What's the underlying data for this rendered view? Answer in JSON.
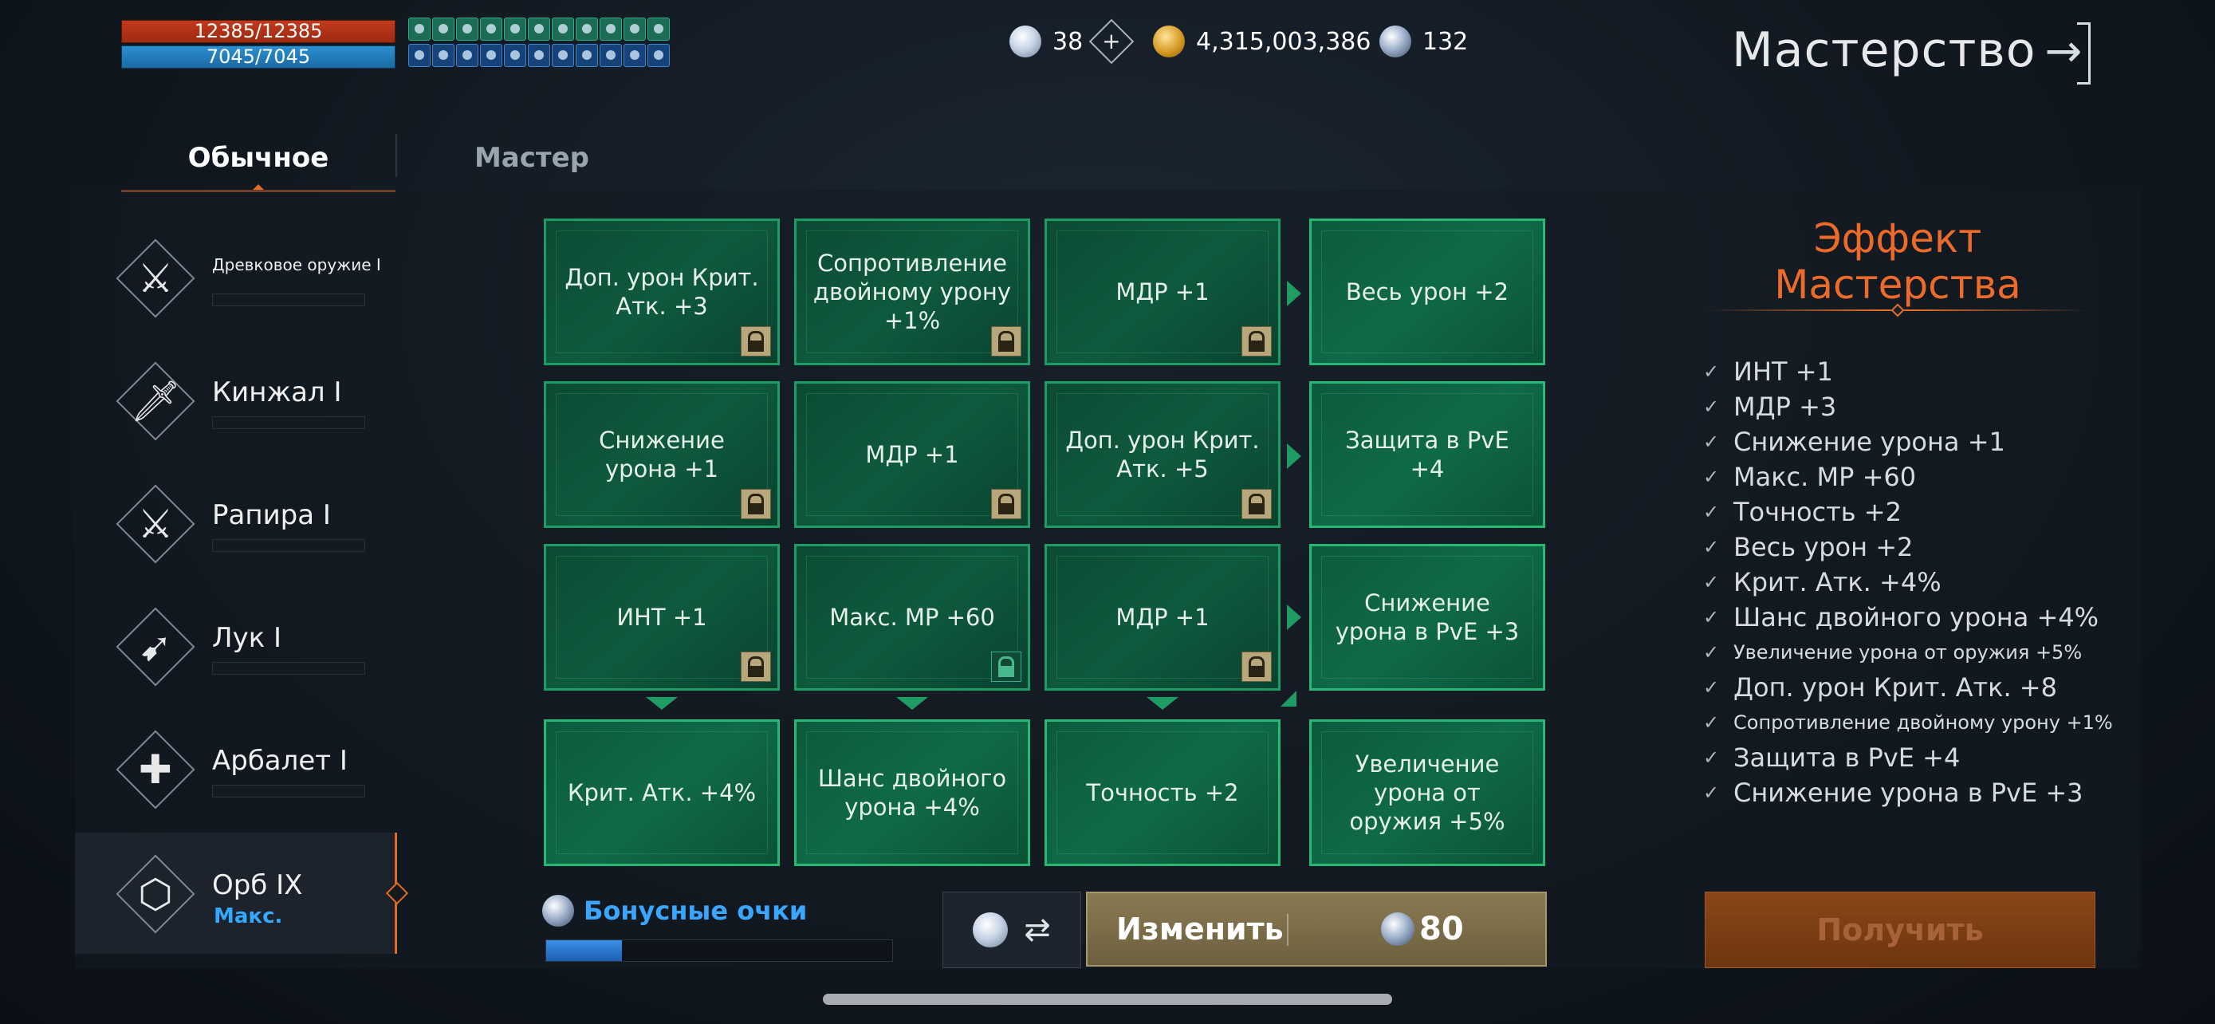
{
  "hud": {
    "hp": "12385/12385",
    "mp": "7045/7045",
    "buffs_green": [
      "buff",
      "buff",
      "buff",
      "buff",
      "buff",
      "buff",
      "buff",
      "buff",
      "buff",
      "buff",
      "buff"
    ],
    "buffs_blue": [
      "buff",
      "buff",
      "buff",
      "buff",
      "buff",
      "buff",
      "buff",
      "buff",
      "buff",
      "buff",
      "buff"
    ]
  },
  "currency": {
    "diamonds": "38",
    "gold": "4,315,003,386",
    "orbs": "132"
  },
  "title": "Мастерство",
  "tabs": [
    {
      "label": "Обычное",
      "active": true
    },
    {
      "label": "Мастер",
      "active": false
    }
  ],
  "weapons": [
    {
      "name": "Древковое оружие",
      "rank": "I"
    },
    {
      "name": "Кинжал",
      "rank": "I"
    },
    {
      "name": "Рапира",
      "rank": "I"
    },
    {
      "name": "Лук",
      "rank": "I"
    },
    {
      "name": "Арбалет",
      "rank": "I"
    },
    {
      "name": "Орб",
      "rank": "IX",
      "status": "Макс."
    }
  ],
  "grid": [
    [
      "Доп. урон Крит.\nАтк. +3",
      "Сопротивление\nдвойному урону\n+1%",
      "МДР +1",
      "Весь урон +2"
    ],
    [
      "Снижение\nурона +1",
      "МДР +1",
      "Доп. урон Крит.\nАтк. +5",
      "Защита в PvE\n+4"
    ],
    [
      "ИНТ +1",
      "Макс. MP +60",
      "МДР +1",
      "Снижение\nурона в PvE +3"
    ],
    [
      "Крит. Атк. +4%",
      "Шанс двойного\nурона +4%",
      "Точность +2",
      "Увеличение\nурона от\nоружия +5%"
    ]
  ],
  "bonus": {
    "label": "Бонусные очки",
    "progress": 0.22
  },
  "change": {
    "label": "Изменить",
    "cost": "80"
  },
  "effects": {
    "title": "Эффект Мастерства",
    "items": [
      "ИНТ +1",
      "МДР +3",
      "Снижение урона +1",
      "Макс. MP +60",
      "Точность +2",
      "Весь урон +2",
      "Крит. Атк. +4%",
      "Шанс двойного урона +4%",
      "Увеличение урона от оружия +5%",
      "Доп. урон Крит. Атк. +8",
      "Сопротивление двойному урону +1%",
      "Защита в PvE +4",
      "Снижение урона в PvE +3"
    ],
    "get_label": "Получить"
  }
}
